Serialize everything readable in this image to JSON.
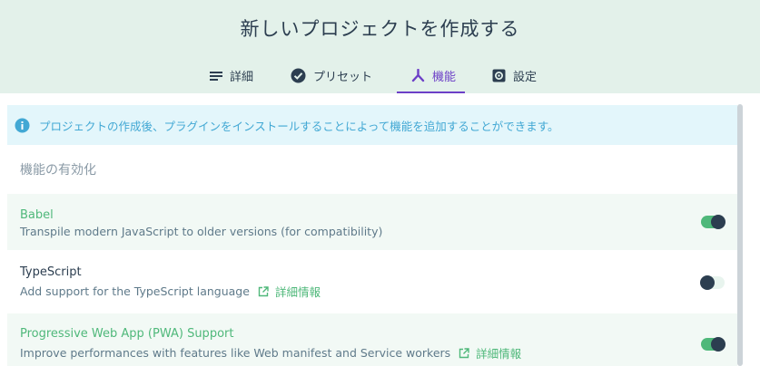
{
  "header": {
    "title": "新しいプロジェクトを作成する",
    "tabs": [
      {
        "label": "詳細",
        "icon": "list-icon",
        "active": false
      },
      {
        "label": "プリセット",
        "icon": "check-circle-icon",
        "active": false
      },
      {
        "label": "機能",
        "icon": "merge-icon",
        "active": true
      },
      {
        "label": "設定",
        "icon": "settings-icon",
        "active": false
      }
    ]
  },
  "info": {
    "icon": "info-icon",
    "text": "プロジェクトの作成後、プラグインをインストールすることによって機能を追加することができます。"
  },
  "features_section": {
    "title": "機能の有効化",
    "more_info_label": "詳細情報",
    "items": [
      {
        "name": "Babel",
        "description": "Transpile modern JavaScript to older versions (for compatibility)",
        "enabled": true,
        "has_more_info": false
      },
      {
        "name": "TypeScript",
        "description": "Add support for the TypeScript language",
        "enabled": false,
        "has_more_info": true
      },
      {
        "name": "Progressive Web App (PWA) Support",
        "description": "Improve performances with features like Web manifest and Service workers",
        "enabled": true,
        "has_more_info": true
      }
    ]
  },
  "colors": {
    "header_bg": "#e3f1ea",
    "accent_green": "#4fb87a",
    "active_tab": "#6c3fc7",
    "info_bg": "#e3f6fb",
    "info_text": "#42a8d4",
    "text_dark": "#2c3e50"
  }
}
